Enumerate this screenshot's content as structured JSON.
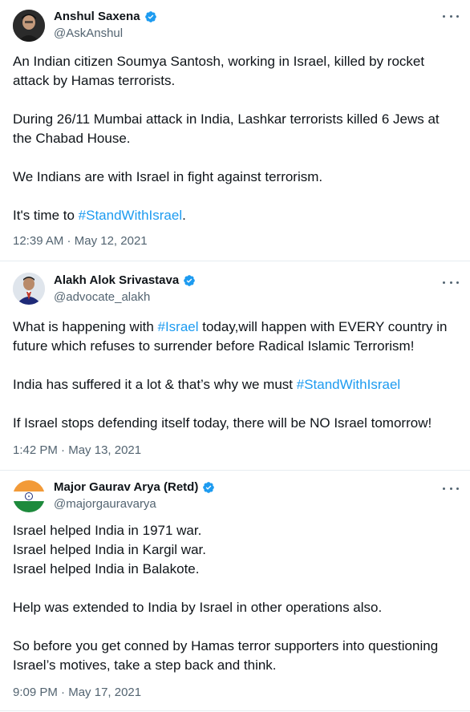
{
  "tweets": [
    {
      "name": "Anshul Saxena",
      "handle": "@AskAnshul",
      "p1": "An Indian citizen Soumya Santosh, working in Israel, killed by rocket attack by Hamas terrorists.",
      "p2": "During 26/11 Mumbai attack in India, Lashkar terrorists killed 6 Jews at the Chabad House.",
      "p3": "We Indians are with Israel in fight against terrorism.",
      "p4_pre": "It's time to ",
      "p4_tag": "#StandWithIsrael",
      "p4_post": ".",
      "time": "12:39 AM",
      "date": "May 12, 2021"
    },
    {
      "name": "Alakh Alok Srivastava",
      "handle": "@advocate_alakh",
      "p1_pre": "What is happening with ",
      "p1_tag": "#Israel",
      "p1_post": " today,will happen with EVERY country in future which refuses to surrender before Radical Islamic Terrorism!",
      "p2_pre": "India has suffered it a lot & that’s why we must ",
      "p2_tag": "#StandWithIsrael",
      "p3": "If Israel stops defending itself today, there will be NO Israel tomorrow!",
      "time": "1:42 PM",
      "date": "May 13, 2021"
    },
    {
      "name": "Major Gaurav Arya (Retd)",
      "handle": "@majorgauravarya",
      "l1": "Israel helped India in 1971 war.",
      "l2": "Israel helped India in Kargil war.",
      "l3": "Israel helped India in Balakote.",
      "p2": "Help was extended to India by Israel in other operations also.",
      "p3": "So before you get conned by Hamas terror supporters into questioning Israel’s motives, take a step back and think.",
      "time": "9:09 PM",
      "date": "May 17, 2021"
    }
  ],
  "separator": " · ",
  "colors": {
    "link": "#1d9bf0",
    "verified": "#1d9bf0",
    "secondary": "#536471"
  },
  "icons": {
    "verified": "verified-badge-icon",
    "more": "more-options-icon"
  }
}
